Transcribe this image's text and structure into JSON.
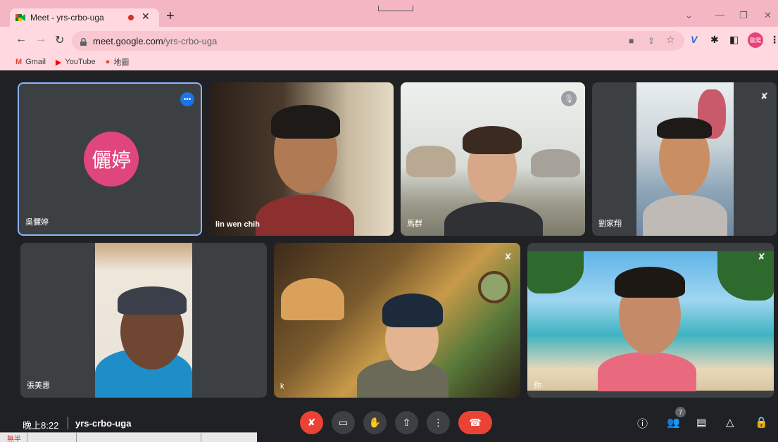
{
  "browser": {
    "tab_title": "Meet - yrs-crbo-uga",
    "url_host": "meet.google.com",
    "url_path": "/yrs-crbo-uga",
    "profile_label": "歐陽",
    "bookmarks": [
      {
        "label": "Gmail",
        "icon": "gmail-icon"
      },
      {
        "label": "YouTube",
        "icon": "youtube-icon"
      },
      {
        "label": "地圖",
        "icon": "maps-icon"
      }
    ],
    "colors": {
      "chrome": "#f3b6c2",
      "toolbar": "#ffd9df"
    }
  },
  "meet": {
    "participants": [
      {
        "name": "吳儷婷",
        "avatar_text": "儷婷",
        "camera_on": false,
        "muted": false,
        "selected": true
      },
      {
        "name": "lin wen chih",
        "camera_on": true,
        "muted": false
      },
      {
        "name": "馬群",
        "camera_on": true,
        "muted": true
      },
      {
        "name": "劉家翔",
        "camera_on": true,
        "muted": true
      },
      {
        "name": "張美惠",
        "camera_on": true,
        "muted": false
      },
      {
        "name": "k",
        "camera_on": true,
        "muted": true
      },
      {
        "name": "你",
        "camera_on": true,
        "muted": true
      }
    ],
    "bottom": {
      "time": "晚上8:22",
      "meeting_code": "yrs-crbo-uga",
      "people_count": "7"
    },
    "colors": {
      "background": "#202124",
      "tile": "#3c4043",
      "danger": "#ea4335",
      "accent": "#8ab4f8"
    }
  },
  "ime": {
    "label": "無半"
  }
}
